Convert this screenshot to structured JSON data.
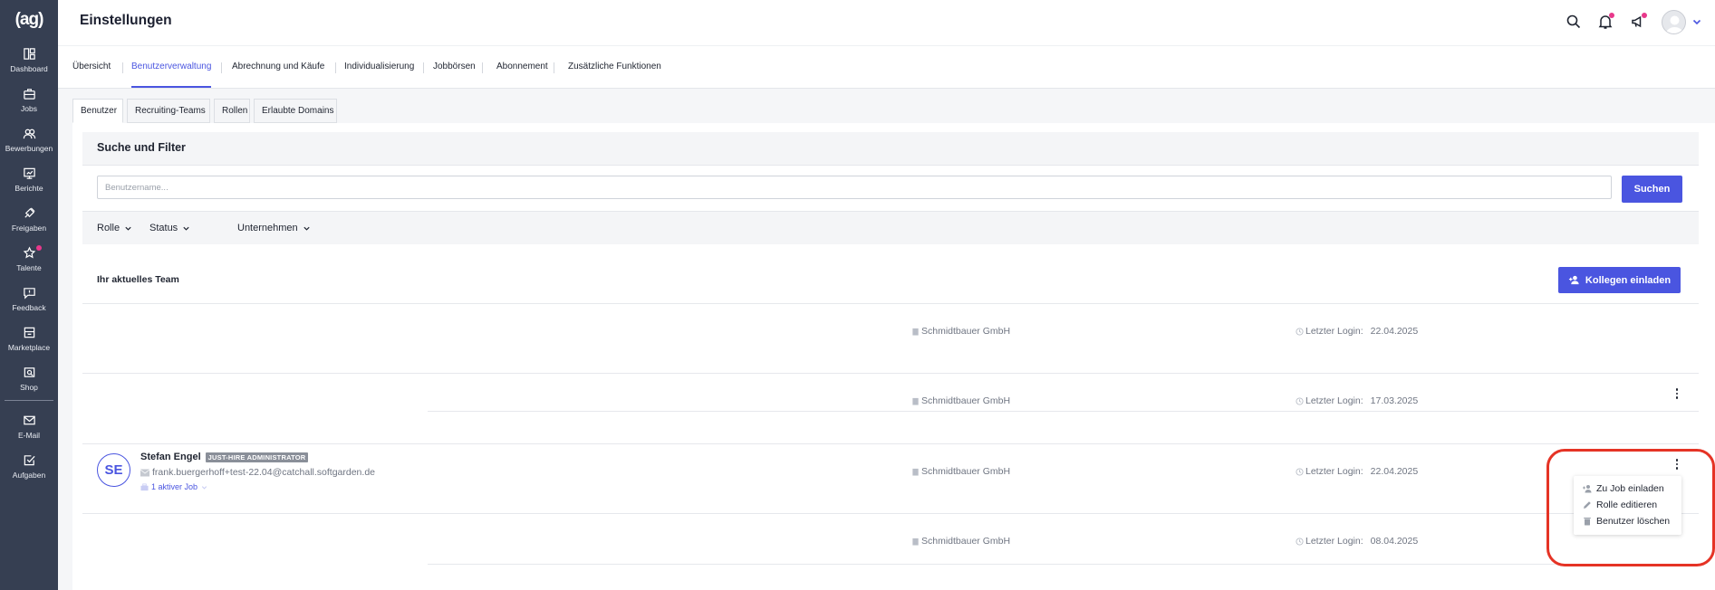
{
  "sidebar": {
    "logo": "(ag)",
    "items": [
      {
        "label": "Dashboard",
        "icon": "dashboard-icon"
      },
      {
        "label": "Jobs",
        "icon": "briefcase-icon"
      },
      {
        "label": "Bewerbungen",
        "icon": "people-icon"
      },
      {
        "label": "Berichte",
        "icon": "report-icon"
      },
      {
        "label": "Freigaben",
        "icon": "approval-icon"
      },
      {
        "label": "Talente",
        "icon": "star-icon"
      },
      {
        "label": "Feedback",
        "icon": "feedback-icon"
      },
      {
        "label": "Marketplace",
        "icon": "store-icon"
      },
      {
        "label": "Shop",
        "icon": "shop-icon"
      },
      {
        "label": "E-Mail",
        "icon": "mail-icon"
      },
      {
        "label": "Aufgaben",
        "icon": "tasks-icon"
      }
    ]
  },
  "header": {
    "title": "Einstellungen"
  },
  "main_tabs": [
    {
      "label": "Übersicht",
      "active": false
    },
    {
      "label": "Benutzerverwaltung",
      "active": true
    },
    {
      "label": "Abrechnung und Käufe",
      "active": false
    },
    {
      "label": "Individualisierung",
      "active": false
    },
    {
      "label": "Jobbörsen",
      "active": false
    },
    {
      "label": "Abonnement",
      "active": false
    },
    {
      "label": "Zusätzliche Funktionen",
      "active": false
    }
  ],
  "sub_tabs": [
    {
      "label": "Benutzer",
      "active": true
    },
    {
      "label": "Recruiting-Teams",
      "active": false
    },
    {
      "label": "Rollen",
      "active": false
    },
    {
      "label": "Erlaubte Domains",
      "active": false
    }
  ],
  "filter": {
    "title": "Suche und Filter",
    "search_placeholder": "Benutzername...",
    "search_button": "Suchen",
    "dropdowns": [
      "Rolle",
      "Status",
      "Unternehmen"
    ]
  },
  "team": {
    "heading": "Ihr aktuelles Team",
    "invite_button": "Kollegen einladen",
    "login_label": "Letzter Login:",
    "rows": [
      {
        "company": "Schmidtbauer GmbH",
        "last_login": "22.04.2025"
      },
      {
        "company": "Schmidtbauer GmbH",
        "last_login": "17.03.2025"
      },
      {
        "initials": "SE",
        "name": "Stefan Engel",
        "role": "JUST-HIRE ADMINISTRATOR",
        "email": "frank.buergerhoff+test-22.04@catchall.softgarden.de",
        "jobs": "1 aktiver Job",
        "company": "Schmidtbauer GmbH",
        "last_login": "22.04.2025"
      },
      {
        "company": "Schmidtbauer GmbH",
        "last_login": "08.04.2025"
      }
    ]
  },
  "context_menu": {
    "items": [
      {
        "label": "Zu Job einladen",
        "icon": "invite-person-icon"
      },
      {
        "label": "Rolle editieren",
        "icon": "pencil-icon"
      },
      {
        "label": "Benutzer löschen",
        "icon": "trash-icon"
      }
    ]
  },
  "colors": {
    "accent": "#4a55e0",
    "sidebar": "#363f52",
    "notification_dot": "#e8388b",
    "highlight": "#e53325"
  }
}
